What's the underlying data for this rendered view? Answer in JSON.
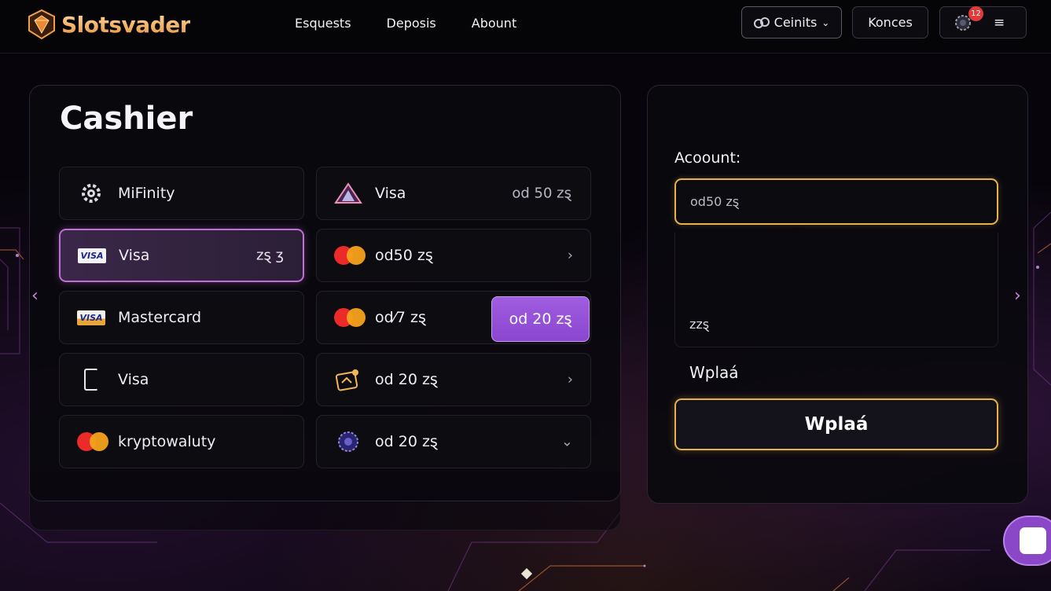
{
  "brand": {
    "name": "Slotsvader",
    "accent": "#e8953f"
  },
  "nav": {
    "items": [
      "Esquests",
      "Deposis",
      "Abount"
    ]
  },
  "header": {
    "currency_label": "Ceinits",
    "konces_label": "Konces",
    "notification_count": "12"
  },
  "cashier": {
    "title": "Cashier",
    "methods_left": [
      {
        "label": "MiFinity",
        "icon": "gear-icon",
        "right": ""
      },
      {
        "label": "Visa",
        "icon": "visa-icon",
        "right": "zȿ ʒ",
        "selected": true
      },
      {
        "label": "Mastercard",
        "icon": "visa-gold-icon",
        "right": ""
      },
      {
        "label": "Visa",
        "icon": "phone-icon",
        "right": ""
      },
      {
        "label": "kryptowaluty",
        "icon": "mastercard-icon",
        "right": ""
      }
    ],
    "methods_right": [
      {
        "label": "Visa",
        "icon": "triangle-logo-icon",
        "right": "od 50 zȿ"
      },
      {
        "label": "od50 zȿ",
        "icon": "mastercard-icon",
        "right": "›"
      },
      {
        "label": "od⁄7 zȿ",
        "icon": "mastercard-icon",
        "right": ""
      },
      {
        "label": "od 20 zȿ",
        "icon": "crypto-icon",
        "right": "›"
      },
      {
        "label": "od 20 zȿ",
        "icon": "coin-icon",
        "right": "⌄"
      }
    ],
    "amount_chip": "od 20 zȿ"
  },
  "deposit_panel": {
    "account_label": "Acoount:",
    "amount_placeholder": "od50 zȿ",
    "summary_currency": "zzȿ",
    "deposit_label": "Wplaá",
    "deposit_button": "Wplaá"
  },
  "colors": {
    "selected_border": "#c06fd4",
    "chip_bg": "#9a55dc",
    "gold_border": "#e7b24c"
  }
}
